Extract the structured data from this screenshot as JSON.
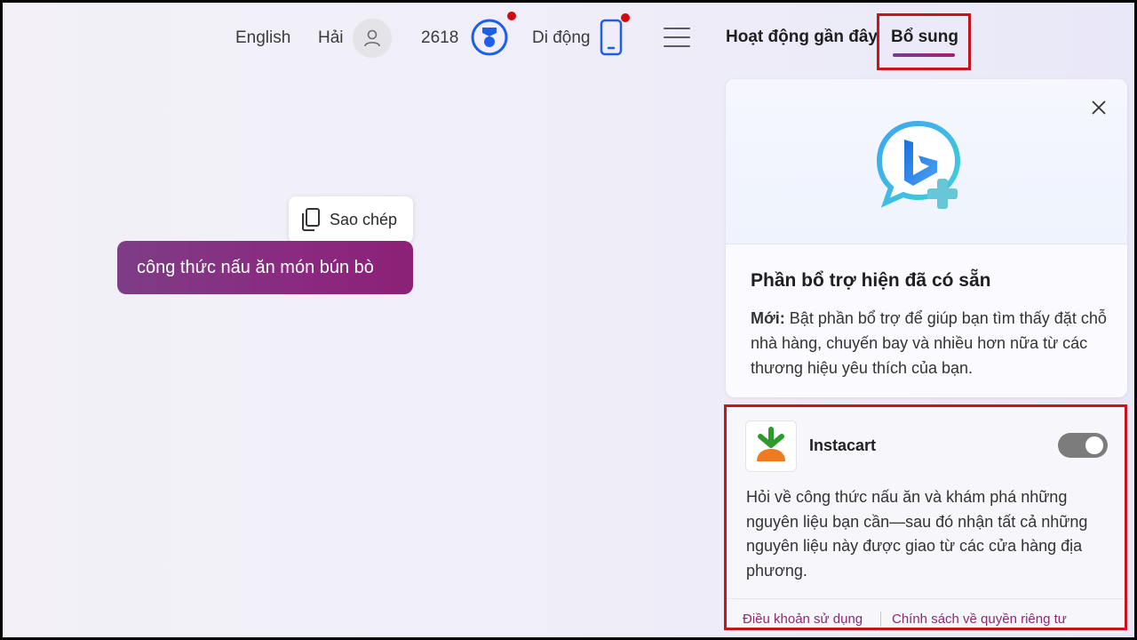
{
  "topbar": {
    "language": "English",
    "user_name": "Hải",
    "reward_points": "2618",
    "mobile_label": "Di động",
    "tabs": [
      {
        "label": "Hoạt động gần đây"
      },
      {
        "label": "Bổ sung"
      }
    ],
    "notification_color": "#d10a11"
  },
  "chat": {
    "copy_label": "Sao chép",
    "user_message": "công thức nấu ăn món bún bò",
    "bubble_color": "#8a2a80"
  },
  "promo": {
    "title": "Phần bổ trợ hiện đã có sẵn",
    "desc_bold": "Mới:",
    "desc_text": " Bật phần bổ trợ để giúp bạn tìm thấy đặt chỗ nhà hàng, chuyến bay và nhiều hơn nữa từ các thương hiệu yêu thích của bạn."
  },
  "plugin": {
    "name": "Instacart",
    "enabled": true,
    "description": "Hỏi về công thức nấu ăn và khám phá những nguyên liệu bạn cần—sau đó nhận tất cả những nguyên liệu này được giao từ các cửa hàng địa phương.",
    "terms_link": "Điều khoản sử dụng",
    "privacy_link": "Chính sách về quyền riêng tư"
  },
  "icons": {
    "avatar": "person-icon",
    "reward": "medal-icon",
    "mobile": "phone-icon",
    "menu": "hamburger-menu-icon",
    "close": "close-icon",
    "copy": "copy-icon",
    "bing": "bing-plugin-icon",
    "instacart": "instacart-carrot-icon"
  },
  "colors": {
    "accent": "#1e5ee8",
    "highlight_box": "#c8141f",
    "link": "#8a2a6f"
  }
}
